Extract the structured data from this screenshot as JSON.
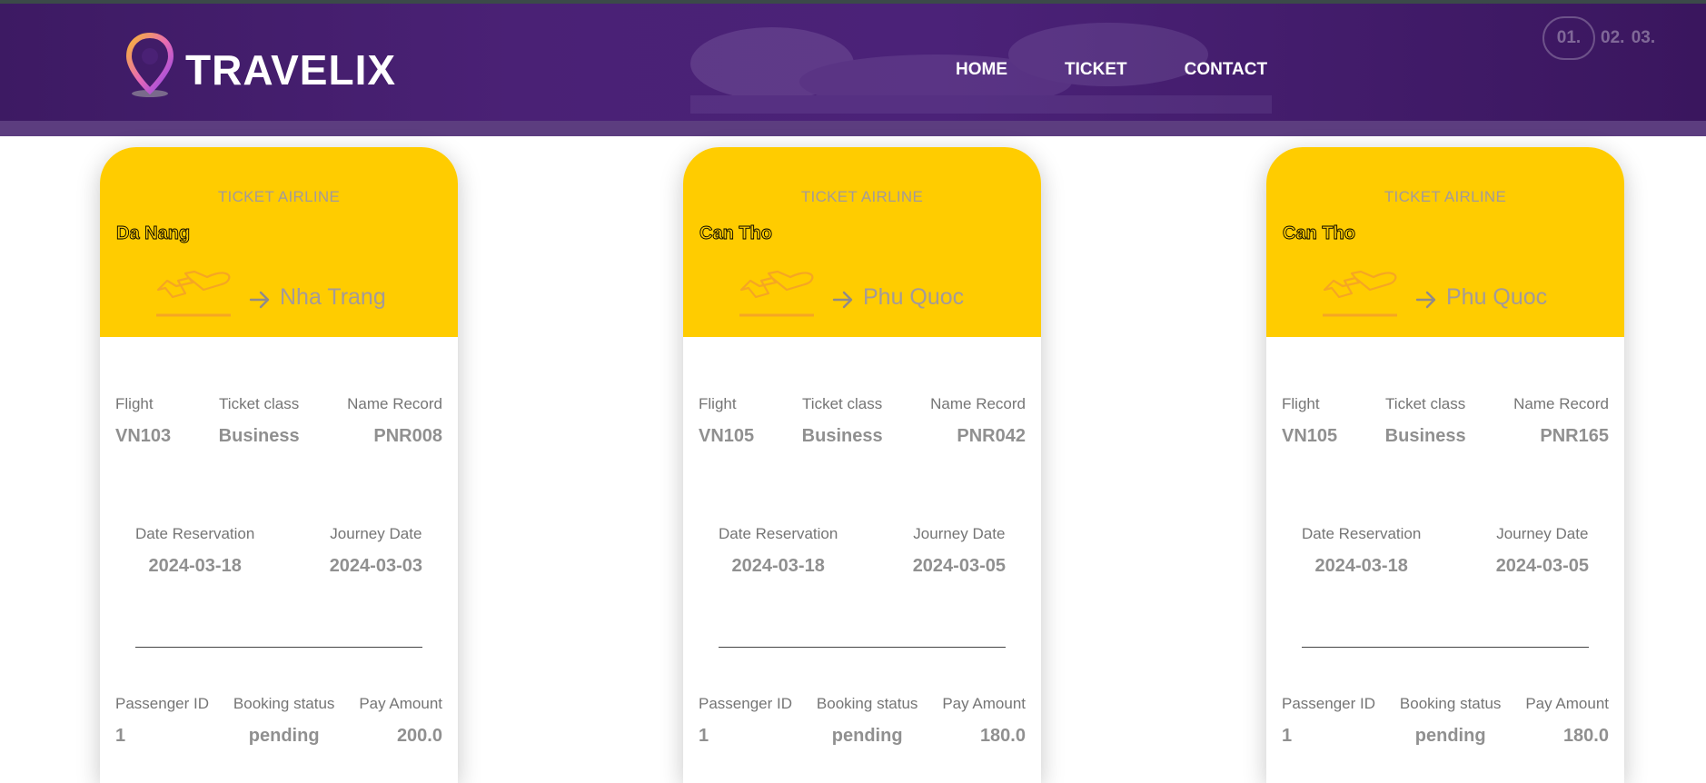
{
  "header": {
    "brand": "TRAVELIX",
    "nav": [
      "HOME",
      "TICKET",
      "CONTACT"
    ],
    "pager": {
      "current": "01.",
      "rest": "02. 03."
    }
  },
  "tickets": [
    {
      "label": "TICKET AIRLINE",
      "from": "Da Nang",
      "to": "Nha Trang",
      "flight": {
        "label": "Flight",
        "value": "VN103"
      },
      "ticket_class": {
        "label": "Ticket class",
        "value": "Business"
      },
      "name_record": {
        "label": "Name Record",
        "value": "PNR008"
      },
      "date_reservation": {
        "label": "Date Reservation",
        "value": "2024-03-18"
      },
      "journey_date": {
        "label": "Journey Date",
        "value": "2024-03-03"
      },
      "passenger_id": {
        "label": "Passenger ID",
        "value": "1"
      },
      "booking_status": {
        "label": "Booking status",
        "value": "pending"
      },
      "pay_amount": {
        "label": "Pay Amount",
        "value": "200.0"
      }
    },
    {
      "label": "TICKET AIRLINE",
      "from": "Can Tho",
      "to": "Phu Quoc",
      "flight": {
        "label": "Flight",
        "value": "VN105"
      },
      "ticket_class": {
        "label": "Ticket class",
        "value": "Business"
      },
      "name_record": {
        "label": "Name Record",
        "value": "PNR042"
      },
      "date_reservation": {
        "label": "Date Reservation",
        "value": "2024-03-18"
      },
      "journey_date": {
        "label": "Journey Date",
        "value": "2024-03-05"
      },
      "passenger_id": {
        "label": "Passenger ID",
        "value": "1"
      },
      "booking_status": {
        "label": "Booking status",
        "value": "pending"
      },
      "pay_amount": {
        "label": "Pay Amount",
        "value": "180.0"
      }
    },
    {
      "label": "TICKET AIRLINE",
      "from": "Can Tho",
      "to": "Phu Quoc",
      "flight": {
        "label": "Flight",
        "value": "VN105"
      },
      "ticket_class": {
        "label": "Ticket class",
        "value": "Business"
      },
      "name_record": {
        "label": "Name Record",
        "value": "PNR165"
      },
      "date_reservation": {
        "label": "Date Reservation",
        "value": "2024-03-18"
      },
      "journey_date": {
        "label": "Journey Date",
        "value": "2024-03-05"
      },
      "passenger_id": {
        "label": "Passenger ID",
        "value": "1"
      },
      "booking_status": {
        "label": "Booking status",
        "value": "pending"
      },
      "pay_amount": {
        "label": "Pay Amount",
        "value": "180.0"
      }
    }
  ],
  "colors": {
    "header_bg": "#4a2175",
    "ticket_accent": "#ffcc00",
    "plane_icon": "#f5a623",
    "muted_text": "#a39a9a"
  },
  "icons": [
    "map-pin-icon",
    "airplane-takeoff-icon",
    "arrow-right-icon"
  ]
}
